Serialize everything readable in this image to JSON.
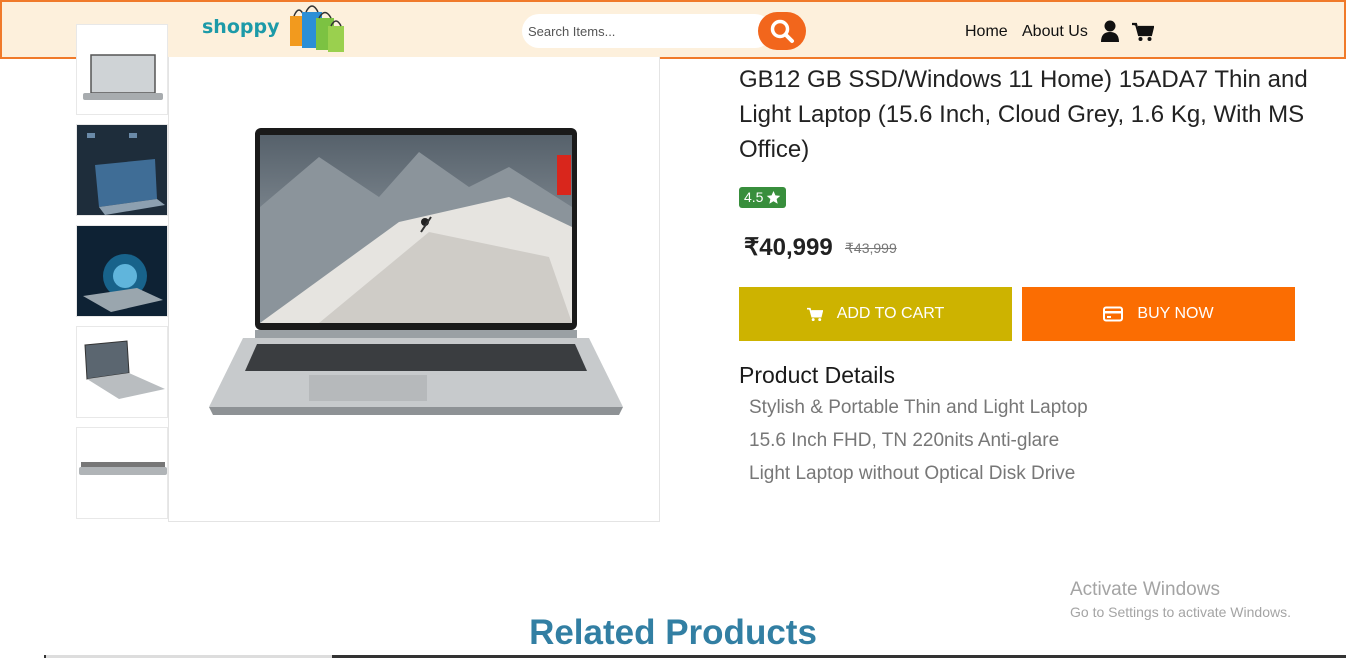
{
  "header": {
    "logo_text": "shoppy",
    "search_placeholder": "Search Items...",
    "nav": {
      "home": "Home",
      "about": "About Us"
    },
    "icons": {
      "search": "search-icon",
      "user": "user-icon",
      "cart": "cart-icon"
    }
  },
  "gallery": {
    "thumbnails": [
      "laptop-front-thumbnail",
      "laptop-features-thumbnail",
      "laptop-battery-thumbnail",
      "laptop-angle-thumbnail",
      "laptop-side-thumbnail"
    ],
    "main_image": "laptop-main-image"
  },
  "product": {
    "title": "GB12 GB SSD/Windows 11 Home) 15ADA7 Thin and Light Laptop (15.6 Inch, Cloud Grey, 1.6 Kg, With MS Office)",
    "rating": "4.5",
    "price": "₹40,999",
    "mrp": "₹43,999",
    "add_to_cart_label": "ADD TO CART",
    "buy_now_label": "BUY NOW",
    "details_heading": "Product Details",
    "features": [
      "Stylish & Portable Thin and Light Laptop",
      "15.6 Inch FHD, TN 220nits Anti-glare",
      "Light Laptop without Optical Disk Drive"
    ]
  },
  "watermark": {
    "line1": "Activate Windows",
    "line2": "Go to Settings to activate Windows."
  },
  "related_heading": "Related Products",
  "colors": {
    "header_bg": "#fdf0dc",
    "header_border": "#f07a2a",
    "add_to_cart": "#cdb300",
    "buy_now": "#fb6d02",
    "rating_badge": "#388e3c",
    "related_heading": "#327fa3"
  }
}
